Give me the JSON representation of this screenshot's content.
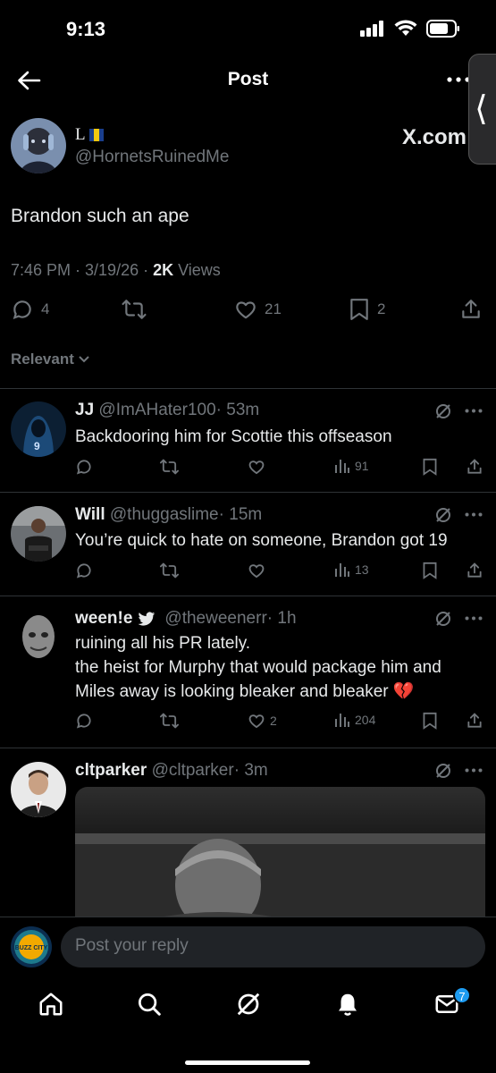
{
  "status": {
    "time": "9:13"
  },
  "header": {
    "title": "Post",
    "side_tab_glyph": "⟨"
  },
  "overlay": {
    "site": "X.com"
  },
  "post": {
    "name": "L",
    "handle": "@HornetsRuinedMe",
    "text": "Brandon such an ape",
    "time": "7:46 PM · 3/19/26 · ",
    "views_count": "2K",
    "views_label": " Views",
    "replies": "4",
    "likes": "21",
    "bookmarks": "2"
  },
  "sort": {
    "label": "Relevant"
  },
  "replies": [
    {
      "name": "JJ",
      "handle": "@ImAHater100",
      "time": "· 53m",
      "lines": [
        "Backdooring him for Scottie this offseason"
      ],
      "likes": "",
      "views": "91"
    },
    {
      "name": "Will",
      "handle": "@thuggaslime",
      "time": "· 15m",
      "lines": [
        "You’re quick to hate on someone, Brandon got 19"
      ],
      "likes": "",
      "views": "13"
    },
    {
      "name": "ween!e",
      "handle": "@theweenerr",
      "time": "· 1h",
      "lines": [
        "ruining all his PR lately.",
        "the heist for Murphy that would package him and",
        "Miles away is looking bleaker and bleaker 💔"
      ],
      "likes": "2",
      "views": "204"
    },
    {
      "name": "cltparker",
      "handle": "@cltparker",
      "time": "· 3m",
      "lines": [],
      "likes": "",
      "views": ""
    }
  ],
  "composer": {
    "placeholder": "Post your reply",
    "avatar_text": "BUZZ CITY"
  },
  "tabbar": {
    "notification_count": "7"
  },
  "colors": {
    "accent": "#1d9bf0",
    "muted": "#71767b",
    "text": "#e7e9ea",
    "background": "#000000"
  }
}
